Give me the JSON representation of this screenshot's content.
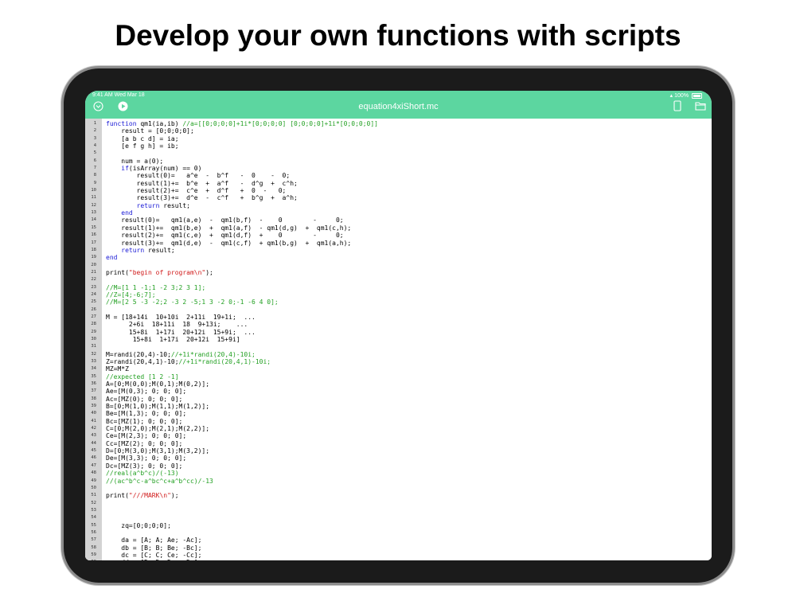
{
  "headline": "Develop your own functions with scripts",
  "status": {
    "time": "9:41 AM  Wed Mar 18",
    "battery": "100%"
  },
  "file_name": "equation4xiShort.mc",
  "nav_icons": [
    "chevron-down-icon",
    "play-icon",
    "tablet-icon",
    "folder-icon"
  ],
  "colors": {
    "accent": "#5cd6a0",
    "keyword": "#1a1ad6",
    "comment": "#22a022",
    "string": "#d01818",
    "gutter": "#d3d3d3"
  },
  "code_lines": [
    [
      [
        "kw",
        "function"
      ],
      [
        "t",
        " qm1(ia,ib) "
      ],
      [
        "cm",
        "//a=[[0;0;0;0]+1i*[0;0;0;0] [0;0;0;0]+1i*[0;0;0;0]]"
      ]
    ],
    [
      [
        "t",
        "    result = [0;0;0;0];"
      ]
    ],
    [
      [
        "t",
        "    [a b c d] = ia;"
      ]
    ],
    [
      [
        "t",
        "    [e f g h] = ib;"
      ]
    ],
    [
      [
        "t",
        ""
      ]
    ],
    [
      [
        "t",
        "    num = a(0);"
      ]
    ],
    [
      [
        "t",
        "    "
      ],
      [
        "kw",
        "if"
      ],
      [
        "t",
        "(isArray(num) == 0)"
      ]
    ],
    [
      [
        "t",
        "        result(0)=   a^e  -  b^f   -  0    -  0;"
      ]
    ],
    [
      [
        "t",
        "        result(1)+=  b^e  +  a^f   -  d^g  +  c^h;"
      ]
    ],
    [
      [
        "t",
        "        result(2)+=  c^e  +  d^f   +  0  -   0;"
      ]
    ],
    [
      [
        "t",
        "        result(3)+=  d^e  -  c^f   +  b^g  +  a^h;"
      ]
    ],
    [
      [
        "t",
        "        "
      ],
      [
        "kw",
        "return"
      ],
      [
        "t",
        " result;"
      ]
    ],
    [
      [
        "t",
        "    "
      ],
      [
        "kw",
        "end"
      ]
    ],
    [
      [
        "t",
        "    result(0)=   qm1(a,e)  -  qm1(b,f)  -    0        -     0;"
      ]
    ],
    [
      [
        "t",
        "    result(1)+=  qm1(b,e)  +  qm1(a,f)  - qm1(d,g)  +  qm1(c,h);"
      ]
    ],
    [
      [
        "t",
        "    result(2)+=  qm1(c,e)  +  qm1(d,f)  +    0        -     0;"
      ]
    ],
    [
      [
        "t",
        "    result(3)+=  qm1(d,e)  -  qm1(c,f)  + qm1(b,g)  +  qm1(a,h);"
      ]
    ],
    [
      [
        "t",
        "    "
      ],
      [
        "kw",
        "return"
      ],
      [
        "t",
        " result;"
      ]
    ],
    [
      [
        "kw",
        "end"
      ]
    ],
    [
      [
        "t",
        ""
      ]
    ],
    [
      [
        "t",
        "print("
      ],
      [
        "st",
        "\"begin of program\\n\""
      ],
      [
        "t",
        ");"
      ]
    ],
    [
      [
        "t",
        ""
      ]
    ],
    [
      [
        "cm",
        "//M=[1 1 -1;1 -2 3;2 3 1];"
      ]
    ],
    [
      [
        "cm",
        "//Z=[4;-6;7];"
      ]
    ],
    [
      [
        "cm",
        "//M=[2 5 -3 -2;2 -3 2 -5;1 3 -2 0;-1 -6 4 0];"
      ]
    ],
    [
      [
        "t",
        ""
      ]
    ],
    [
      [
        "t",
        "M = [18+14i  10+10i  2+11i  19+1i;  ..."
      ]
    ],
    [
      [
        "t",
        "      2+6i  18+11i  18  9+13i;    ..."
      ]
    ],
    [
      [
        "t",
        "      15+8i  1+17i  20+12i  15+9i;  ..."
      ]
    ],
    [
      [
        "t",
        "       15+8i  1+17i  20+12i  15+9i]"
      ]
    ],
    [
      [
        "t",
        ""
      ]
    ],
    [
      [
        "t",
        "M=randi(20,4)-10;"
      ],
      [
        "cm",
        "//+1i*randi(20,4)-10i;"
      ]
    ],
    [
      [
        "t",
        "Z=randi(20,4,1)-10;"
      ],
      [
        "cm",
        "//+1i*randi(20,4,1)-10i;"
      ]
    ],
    [
      [
        "t",
        "MZ=M*Z"
      ]
    ],
    [
      [
        "cm",
        "//expected [1 2 -1]"
      ]
    ],
    [
      [
        "t",
        "A=[0;M(0,0);M(0,1);M(0,2)];"
      ]
    ],
    [
      [
        "t",
        "Ae=[M(0,3); 0; 0; 0];"
      ]
    ],
    [
      [
        "t",
        "Ac=[MZ(0); 0; 0; 0];"
      ]
    ],
    [
      [
        "t",
        "B=[0;M(1,0);M(1,1);M(1,2)];"
      ]
    ],
    [
      [
        "t",
        "Be=[M(1,3); 0; 0; 0];"
      ]
    ],
    [
      [
        "t",
        "Bc=[MZ(1); 0; 0; 0];"
      ]
    ],
    [
      [
        "t",
        "C=[0;M(2,0);M(2,1);M(2,2)];"
      ]
    ],
    [
      [
        "t",
        "Ce=[M(2,3); 0; 0; 0];"
      ]
    ],
    [
      [
        "t",
        "Cc=[MZ(2); 0; 0; 0];"
      ]
    ],
    [
      [
        "t",
        "D=[0;M(3,0);M(3,1);M(3,2)];"
      ]
    ],
    [
      [
        "t",
        "De=[M(3,3); 0; 0; 0];"
      ]
    ],
    [
      [
        "t",
        "Dc=[MZ(3); 0; 0; 0];"
      ]
    ],
    [
      [
        "cm",
        "//real(a^b^c)/(-13)"
      ]
    ],
    [
      [
        "cm",
        "//(ac^b^c-a^bc^c+a^b^cc)/-13"
      ]
    ],
    [
      [
        "t",
        ""
      ]
    ],
    [
      [
        "t",
        "print("
      ],
      [
        "st",
        "\"///MARK\\n\""
      ],
      [
        "t",
        ");"
      ]
    ],
    [
      [
        "t",
        ""
      ]
    ],
    [
      [
        "t",
        ""
      ]
    ],
    [
      [
        "t",
        ""
      ]
    ],
    [
      [
        "t",
        "    zq=[0;0;0;0];"
      ]
    ],
    [
      [
        "t",
        ""
      ]
    ],
    [
      [
        "t",
        "    da = [A; A; Ae; -Ac];"
      ]
    ],
    [
      [
        "t",
        "    db = [B; B; Be; -Bc];"
      ]
    ],
    [
      [
        "t",
        "    dc = [C; C; Ce; -Cc];"
      ]
    ],
    [
      [
        "t",
        "    dd = [D; D; De; -Dc];"
      ]
    ]
  ]
}
